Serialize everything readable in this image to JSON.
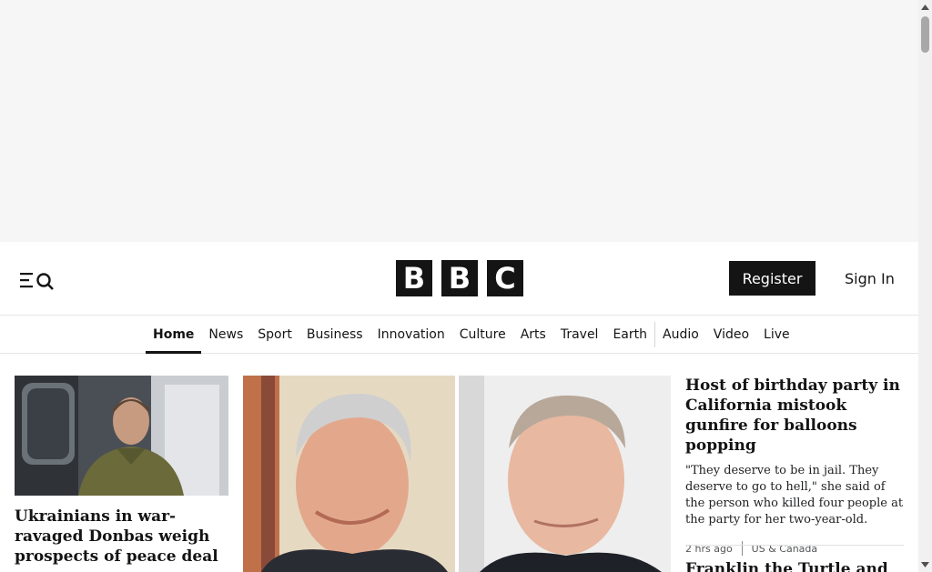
{
  "header": {
    "menu_icon": "menu-search-icon",
    "logo_letters": [
      "B",
      "B",
      "C"
    ],
    "register_label": "Register",
    "signin_label": "Sign In"
  },
  "nav": {
    "items": [
      {
        "label": "Home",
        "active": true
      },
      {
        "label": "News"
      },
      {
        "label": "Sport"
      },
      {
        "label": "Business"
      },
      {
        "label": "Innovation"
      },
      {
        "label": "Culture"
      },
      {
        "label": "Arts"
      },
      {
        "label": "Travel"
      },
      {
        "label": "Earth"
      },
      {
        "label": "Audio"
      },
      {
        "label": "Video"
      },
      {
        "label": "Live"
      }
    ]
  },
  "stories": {
    "left": {
      "title": "Ukrainians in war-ravaged Donbas weigh prospects of peace deal"
    },
    "right": {
      "title": "Host of birthday party in California mistook gunfire for balloons popping",
      "summary": "\"They deserve to be in jail. They deserve to go to hell,\" she said of the person who killed four people at the party for her two-year-old.",
      "time": "2 hrs ago",
      "section": "US & Canada"
    },
    "right_next": {
      "title": "Franklin the Turtle and"
    }
  },
  "colors": {
    "brand_black": "#141414",
    "ad_background": "#f6f6f6"
  }
}
